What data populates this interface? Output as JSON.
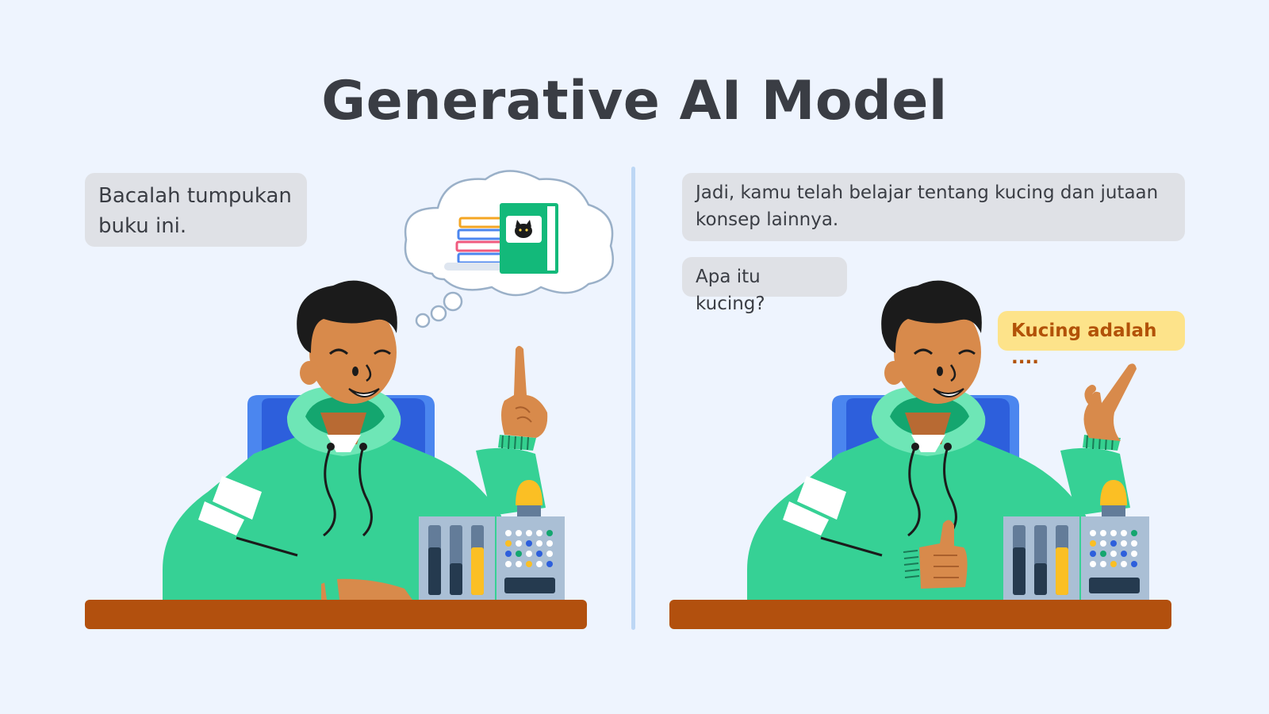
{
  "title": "Generative AI Model",
  "left_panel": {
    "bubble": "Bacalah tumpukan buku ini."
  },
  "right_panel": {
    "bubble_1": "Jadi, kamu telah belajar tentang kucing dan jutaan konsep lainnya.",
    "bubble_2": "Apa itu kucing?",
    "answer": "Kucing adalah ...."
  },
  "colors": {
    "background": "#eef4fe",
    "hoodie": "#36d195",
    "desk": "#b2500e",
    "chair": "#2d5fdc",
    "skin": "#d88a4b",
    "book": "#13b97a",
    "answer_bubble": "#fde38a"
  }
}
